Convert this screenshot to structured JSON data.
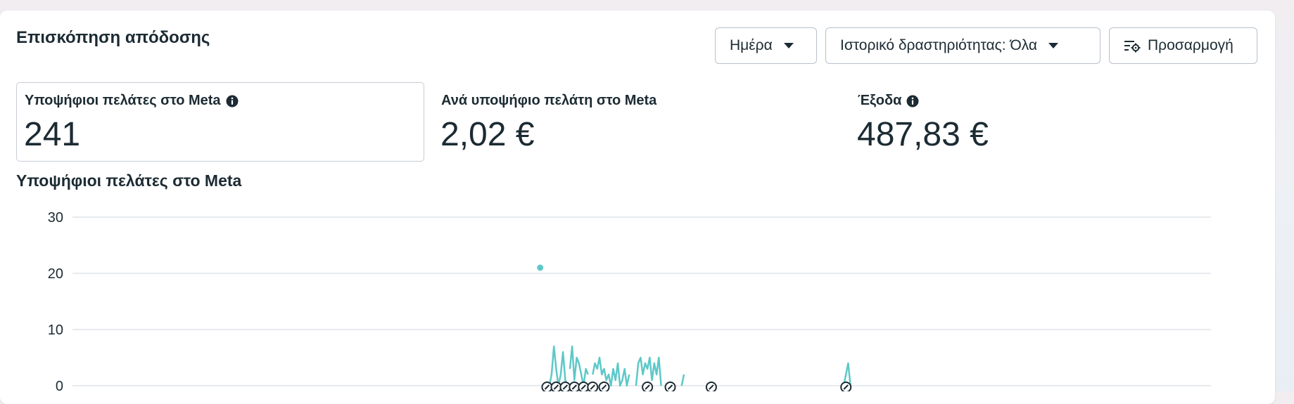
{
  "section": {
    "title": "Επισκόπηση απόδοσης"
  },
  "controls": {
    "day_label": "Ημέρα",
    "history_label": "Ιστορικό δραστηριότητας: Όλα",
    "customize_label": "Προσαρμογή"
  },
  "metrics": [
    {
      "label": "Υποψήφιοι πελάτες στο Meta",
      "value": "241",
      "info": true
    },
    {
      "label": "Ανά υποψήφιο πελάτη στο Meta",
      "value": "2,02 €",
      "info": false
    },
    {
      "label": "Έξοδα",
      "value": "487,83 €",
      "info": true
    }
  ],
  "chart_title": "Υποψήφιοι πελάτες στο Meta",
  "chart_data": {
    "type": "line",
    "ylim": [
      0,
      30
    ],
    "yticks": [
      "30",
      "20",
      "10",
      "0"
    ],
    "grid": true,
    "color": "#5ec8c8",
    "x": [
      0,
      1,
      2,
      3,
      4,
      5,
      6,
      7,
      8,
      9,
      10,
      11,
      12,
      13,
      14,
      15,
      16,
      17,
      18,
      19,
      20,
      21,
      22,
      23,
      24,
      25,
      26,
      27,
      28,
      29,
      30,
      31,
      32,
      33,
      34,
      35,
      36,
      37,
      38,
      39,
      40,
      41,
      42,
      43,
      44,
      45,
      46,
      47,
      48,
      49,
      50,
      51,
      52,
      53,
      54,
      55,
      56,
      57,
      58,
      59,
      60,
      61,
      62,
      63,
      64,
      65,
      66,
      67,
      68,
      69,
      70,
      71,
      72,
      73,
      74,
      75,
      76,
      77,
      78,
      79,
      80,
      81,
      82,
      83,
      84,
      85,
      86,
      87,
      88,
      89,
      90,
      91,
      92,
      93,
      94,
      95,
      96,
      97,
      98,
      99,
      100,
      101,
      102,
      103,
      104,
      105,
      106,
      107,
      108,
      109,
      110,
      111,
      112,
      113,
      114,
      115,
      116,
      117,
      118,
      119,
      120,
      121,
      122,
      123,
      124,
      125,
      126,
      127,
      128,
      129,
      130,
      131,
      132,
      133,
      134,
      135,
      136,
      137,
      138,
      139,
      140,
      141,
      142,
      143,
      144,
      145,
      146,
      147,
      148,
      149,
      150,
      151,
      152,
      153,
      154,
      155,
      156,
      157,
      158,
      159,
      160,
      161,
      162,
      163,
      164,
      165,
      166,
      167,
      168,
      169,
      170,
      171,
      172,
      173,
      174,
      175,
      176,
      177,
      178,
      179,
      180,
      181,
      182,
      183,
      184,
      185,
      186,
      187,
      188,
      189,
      190,
      191,
      192,
      193,
      194,
      195,
      196,
      197,
      198,
      199,
      200,
      201,
      202,
      203,
      204,
      205,
      206,
      207,
      208,
      209,
      210,
      211,
      212,
      213,
      214,
      215,
      216,
      217,
      218,
      219,
      220,
      221,
      222,
      223,
      224,
      225,
      226,
      227,
      228,
      229,
      230,
      231,
      232,
      233,
      234,
      235,
      236,
      237,
      238,
      239,
      240,
      241,
      242,
      243,
      244,
      245,
      246,
      247,
      248,
      249,
      250,
      251,
      252,
      253,
      254,
      255,
      256,
      257,
      258,
      259,
      260,
      261,
      262,
      263,
      264,
      265,
      266,
      267,
      268,
      269,
      270,
      271,
      272,
      273,
      274,
      275,
      276,
      277,
      278,
      279,
      280,
      281,
      282,
      283,
      284,
      285,
      286,
      287,
      288,
      289,
      290,
      291,
      292,
      293,
      294,
      295,
      296,
      297,
      298,
      299,
      300,
      301,
      302,
      303,
      304,
      305,
      306,
      307,
      308,
      309,
      310,
      311,
      312,
      313,
      314,
      315,
      316,
      317,
      318,
      319,
      320,
      321,
      322,
      323,
      324,
      325,
      326,
      327,
      328,
      329,
      330,
      331,
      332,
      333,
      334,
      335,
      336,
      337,
      338,
      339,
      340,
      341,
      342,
      343,
      344,
      345,
      346,
      347,
      348,
      349,
      350,
      351,
      352,
      353,
      354,
      355,
      356,
      357,
      358,
      359,
      360,
      361,
      362,
      363,
      364,
      365,
      366,
      367,
      368,
      369,
      370,
      371,
      372,
      373,
      374,
      375,
      376,
      377,
      378,
      379,
      380,
      381,
      382,
      383,
      384,
      385,
      386,
      387,
      388,
      389,
      390,
      391,
      392,
      393,
      394,
      395,
      396,
      397,
      398,
      399,
      400,
      401,
      402,
      403,
      404,
      405,
      406,
      407,
      408,
      409,
      410,
      411,
      412,
      413,
      414,
      415,
      416,
      417,
      418,
      419,
      420,
      421,
      422,
      423,
      424,
      425,
      426,
      427,
      428,
      429,
      430,
      431,
      432,
      433,
      434,
      435,
      436,
      437,
      438,
      439,
      440,
      441,
      442,
      443,
      444,
      445,
      446,
      447,
      448,
      449,
      450,
      451,
      452,
      453,
      454,
      455,
      456,
      457,
      458,
      459,
      460,
      461,
      462,
      463,
      464,
      465,
      466,
      467,
      468,
      469,
      470,
      471,
      472,
      473,
      474,
      475,
      476,
      477,
      478,
      479,
      480,
      481,
      482,
      483,
      484,
      485,
      486,
      487,
      488,
      489,
      490,
      491,
      492,
      493,
      494,
      495,
      496,
      497,
      498,
      499
    ],
    "segments": [
      {
        "points": [
          [
            205,
            21
          ]
        ]
      },
      {
        "points": [
          [
            209,
            0
          ],
          [
            210,
            2
          ],
          [
            211,
            7
          ],
          [
            212,
            3
          ],
          [
            213,
            0
          ],
          [
            214,
            2
          ],
          [
            215,
            6
          ],
          [
            216,
            1
          ],
          [
            217,
            0
          ]
        ]
      },
      {
        "points": [
          [
            218,
            3
          ],
          [
            219,
            7
          ],
          [
            220,
            1
          ],
          [
            221,
            5
          ],
          [
            222,
            4
          ],
          [
            223,
            2
          ],
          [
            224,
            0
          ],
          [
            225,
            3
          ],
          [
            226,
            2
          ]
        ]
      },
      {
        "points": [
          [
            228,
            2
          ],
          [
            229,
            4
          ],
          [
            230,
            3
          ],
          [
            231,
            5
          ],
          [
            232,
            2
          ],
          [
            233,
            3
          ],
          [
            234,
            1
          ],
          [
            235,
            2
          ],
          [
            236,
            0
          ],
          [
            237,
            3
          ],
          [
            238,
            1
          ],
          [
            239,
            4
          ],
          [
            240,
            0
          ],
          [
            241,
            1
          ],
          [
            242,
            3
          ],
          [
            243,
            0
          ],
          [
            244,
            2
          ]
        ]
      },
      {
        "points": [
          [
            247,
            0
          ],
          [
            248,
            4
          ],
          [
            249,
            5
          ],
          [
            250,
            2
          ],
          [
            251,
            4
          ],
          [
            252,
            3
          ],
          [
            253,
            5
          ],
          [
            254,
            1
          ],
          [
            255,
            4
          ],
          [
            256,
            2
          ],
          [
            257,
            5
          ],
          [
            258,
            0
          ]
        ]
      },
      {
        "points": [
          [
            267,
            0
          ],
          [
            268,
            2
          ]
        ]
      },
      {
        "points": [
          [
            338,
            0
          ],
          [
            339,
            2
          ],
          [
            340,
            4
          ],
          [
            341,
            0
          ]
        ]
      }
    ],
    "annotations_x": [
      208,
      212,
      216,
      220,
      224,
      228,
      233,
      252,
      262,
      280,
      339
    ]
  }
}
